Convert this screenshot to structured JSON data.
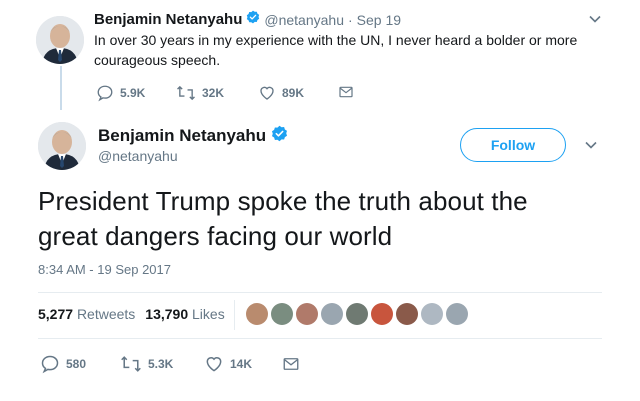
{
  "parent_tweet": {
    "name": "Benjamin Netanyahu",
    "handle": "@netanyahu",
    "separator": "·",
    "date": "Sep 19",
    "text_line1": "In over 30 years in my experience with the UN, I never heard a bolder or more",
    "text_line2": "courageous speech.",
    "replies": "5.9K",
    "retweets": "32K",
    "likes": "89K"
  },
  "main_tweet": {
    "name": "Benjamin Netanyahu",
    "handle": "@netanyahu",
    "follow_label": "Follow",
    "text_line1": "President Trump spoke the truth about the",
    "text_line2": "great dangers facing our world",
    "timestamp": "8:34 AM - 19 Sep 2017",
    "retweet_count": "5,277",
    "retweet_label": "Retweets",
    "like_count": "13,790",
    "like_label": "Likes",
    "replies": "580",
    "retweets": "5.3K",
    "likes": "14K"
  },
  "icons": {
    "verified": "verified-badge-icon",
    "reply": "reply-icon",
    "retweet": "retweet-icon",
    "like": "heart-icon",
    "dm": "envelope-icon",
    "more": "chevron-down-icon"
  },
  "colors": {
    "brand": "#1da1f2",
    "secondary_text": "#657786",
    "primary_text": "#14171a",
    "divider": "#e6ecf0"
  },
  "liker_avatar_colors": [
    "#b98b6e",
    "#7a8d80",
    "#b07a6a",
    "#9aa6b0",
    "#6f7a72",
    "#c8553d",
    "#8a5a4a",
    "#aeb8c2",
    "#9aa6b0"
  ]
}
